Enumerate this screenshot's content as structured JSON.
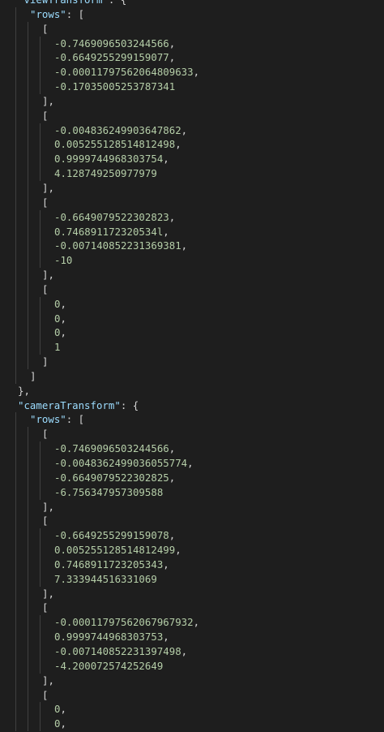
{
  "editor": {
    "colors": {
      "background": "#1e1e1e",
      "text": "#d4d4d4",
      "guide": "#404040"
    },
    "lines": [
      {
        "indent": 1,
        "parts": [
          {
            "t": "\"viewTransform\"",
            "k": "key"
          },
          {
            "t": ": {",
            "k": "punc"
          }
        ]
      },
      {
        "indent": 2,
        "parts": [
          {
            "t": "\"rows\"",
            "k": "key"
          },
          {
            "t": ": [",
            "k": "punc"
          }
        ]
      },
      {
        "indent": 3,
        "parts": [
          {
            "t": "[",
            "k": "punc"
          }
        ]
      },
      {
        "indent": 4,
        "parts": [
          {
            "t": "-0.7469096503244566",
            "k": "num"
          },
          {
            "t": ",",
            "k": "punc"
          }
        ]
      },
      {
        "indent": 4,
        "parts": [
          {
            "t": "-0.6649255299159077",
            "k": "num"
          },
          {
            "t": ",",
            "k": "punc"
          }
        ]
      },
      {
        "indent": 4,
        "parts": [
          {
            "t": "-0.00011797562064809633",
            "k": "num"
          },
          {
            "t": ",",
            "k": "punc"
          }
        ]
      },
      {
        "indent": 4,
        "parts": [
          {
            "t": "-0.17035005253787341",
            "k": "num"
          }
        ]
      },
      {
        "indent": 3,
        "parts": [
          {
            "t": "],",
            "k": "punc"
          }
        ]
      },
      {
        "indent": 3,
        "parts": [
          {
            "t": "[",
            "k": "punc"
          }
        ]
      },
      {
        "indent": 4,
        "parts": [
          {
            "t": "-0.004836249903647862",
            "k": "num"
          },
          {
            "t": ",",
            "k": "punc"
          }
        ]
      },
      {
        "indent": 4,
        "parts": [
          {
            "t": "0.005255128514812498",
            "k": "num"
          },
          {
            "t": ",",
            "k": "punc"
          }
        ]
      },
      {
        "indent": 4,
        "parts": [
          {
            "t": "0.9999744968303754",
            "k": "num"
          },
          {
            "t": ",",
            "k": "punc"
          }
        ]
      },
      {
        "indent": 4,
        "parts": [
          {
            "t": "4.128749250977979",
            "k": "num"
          }
        ]
      },
      {
        "indent": 3,
        "parts": [
          {
            "t": "],",
            "k": "punc"
          }
        ]
      },
      {
        "indent": 3,
        "parts": [
          {
            "t": "[",
            "k": "punc"
          }
        ]
      },
      {
        "indent": 4,
        "parts": [
          {
            "t": "-0.6649079522302823",
            "k": "num"
          },
          {
            "t": ",",
            "k": "punc"
          }
        ]
      },
      {
        "indent": 4,
        "parts": [
          {
            "t": "0.746891172320534l",
            "k": "num"
          },
          {
            "t": ",",
            "k": "punc"
          }
        ]
      },
      {
        "indent": 4,
        "parts": [
          {
            "t": "-0.007140852231369381",
            "k": "num"
          },
          {
            "t": ",",
            "k": "punc"
          }
        ]
      },
      {
        "indent": 4,
        "parts": [
          {
            "t": "-10",
            "k": "num"
          }
        ]
      },
      {
        "indent": 3,
        "parts": [
          {
            "t": "],",
            "k": "punc"
          }
        ]
      },
      {
        "indent": 3,
        "parts": [
          {
            "t": "[",
            "k": "punc"
          }
        ]
      },
      {
        "indent": 4,
        "parts": [
          {
            "t": "0",
            "k": "num"
          },
          {
            "t": ",",
            "k": "punc"
          }
        ]
      },
      {
        "indent": 4,
        "parts": [
          {
            "t": "0",
            "k": "num"
          },
          {
            "t": ",",
            "k": "punc"
          }
        ]
      },
      {
        "indent": 4,
        "parts": [
          {
            "t": "0",
            "k": "num"
          },
          {
            "t": ",",
            "k": "punc"
          }
        ]
      },
      {
        "indent": 4,
        "parts": [
          {
            "t": "1",
            "k": "num"
          }
        ]
      },
      {
        "indent": 3,
        "parts": [
          {
            "t": "]",
            "k": "punc"
          }
        ]
      },
      {
        "indent": 2,
        "parts": [
          {
            "t": "]",
            "k": "punc"
          }
        ]
      },
      {
        "indent": 1,
        "parts": [
          {
            "t": "},",
            "k": "punc"
          }
        ]
      },
      {
        "indent": 1,
        "parts": [
          {
            "t": "\"cameraTransform\"",
            "k": "key"
          },
          {
            "t": ": {",
            "k": "punc"
          }
        ]
      },
      {
        "indent": 2,
        "parts": [
          {
            "t": "\"rows\"",
            "k": "key"
          },
          {
            "t": ": [",
            "k": "punc"
          }
        ]
      },
      {
        "indent": 3,
        "parts": [
          {
            "t": "[",
            "k": "punc"
          }
        ]
      },
      {
        "indent": 4,
        "parts": [
          {
            "t": "-0.7469096503244566",
            "k": "num"
          },
          {
            "t": ",",
            "k": "punc"
          }
        ]
      },
      {
        "indent": 4,
        "parts": [
          {
            "t": "-0.0048362499036055774",
            "k": "num"
          },
          {
            "t": ",",
            "k": "punc"
          }
        ]
      },
      {
        "indent": 4,
        "parts": [
          {
            "t": "-0.6649079522302825",
            "k": "num"
          },
          {
            "t": ",",
            "k": "punc"
          }
        ]
      },
      {
        "indent": 4,
        "parts": [
          {
            "t": "-6.756347957309588",
            "k": "num"
          }
        ]
      },
      {
        "indent": 3,
        "parts": [
          {
            "t": "],",
            "k": "punc"
          }
        ]
      },
      {
        "indent": 3,
        "parts": [
          {
            "t": "[",
            "k": "punc"
          }
        ]
      },
      {
        "indent": 4,
        "parts": [
          {
            "t": "-0.6649255299159078",
            "k": "num"
          },
          {
            "t": ",",
            "k": "punc"
          }
        ]
      },
      {
        "indent": 4,
        "parts": [
          {
            "t": "0.005255128514812499",
            "k": "num"
          },
          {
            "t": ",",
            "k": "punc"
          }
        ]
      },
      {
        "indent": 4,
        "parts": [
          {
            "t": "0.746891172320534З",
            "k": "num"
          },
          {
            "t": ",",
            "k": "punc"
          }
        ]
      },
      {
        "indent": 4,
        "parts": [
          {
            "t": "7.333944516331069",
            "k": "num"
          }
        ]
      },
      {
        "indent": 3,
        "parts": [
          {
            "t": "],",
            "k": "punc"
          }
        ]
      },
      {
        "indent": 3,
        "parts": [
          {
            "t": "[",
            "k": "punc"
          }
        ]
      },
      {
        "indent": 4,
        "parts": [
          {
            "t": "-0.00011797562067967932",
            "k": "num"
          },
          {
            "t": ",",
            "k": "punc"
          }
        ]
      },
      {
        "indent": 4,
        "parts": [
          {
            "t": "0.9999744968303753",
            "k": "num"
          },
          {
            "t": ",",
            "k": "punc"
          }
        ]
      },
      {
        "indent": 4,
        "parts": [
          {
            "t": "-0.007140852231397498",
            "k": "num"
          },
          {
            "t": ",",
            "k": "punc"
          }
        ]
      },
      {
        "indent": 4,
        "parts": [
          {
            "t": "-4.200072574252649",
            "k": "num"
          }
        ]
      },
      {
        "indent": 3,
        "parts": [
          {
            "t": "],",
            "k": "punc"
          }
        ]
      },
      {
        "indent": 3,
        "parts": [
          {
            "t": "[",
            "k": "punc"
          }
        ]
      },
      {
        "indent": 4,
        "parts": [
          {
            "t": "0",
            "k": "num"
          },
          {
            "t": ",",
            "k": "punc"
          }
        ]
      },
      {
        "indent": 4,
        "parts": [
          {
            "t": "0",
            "k": "num"
          },
          {
            "t": ",",
            "k": "punc"
          }
        ]
      }
    ]
  }
}
